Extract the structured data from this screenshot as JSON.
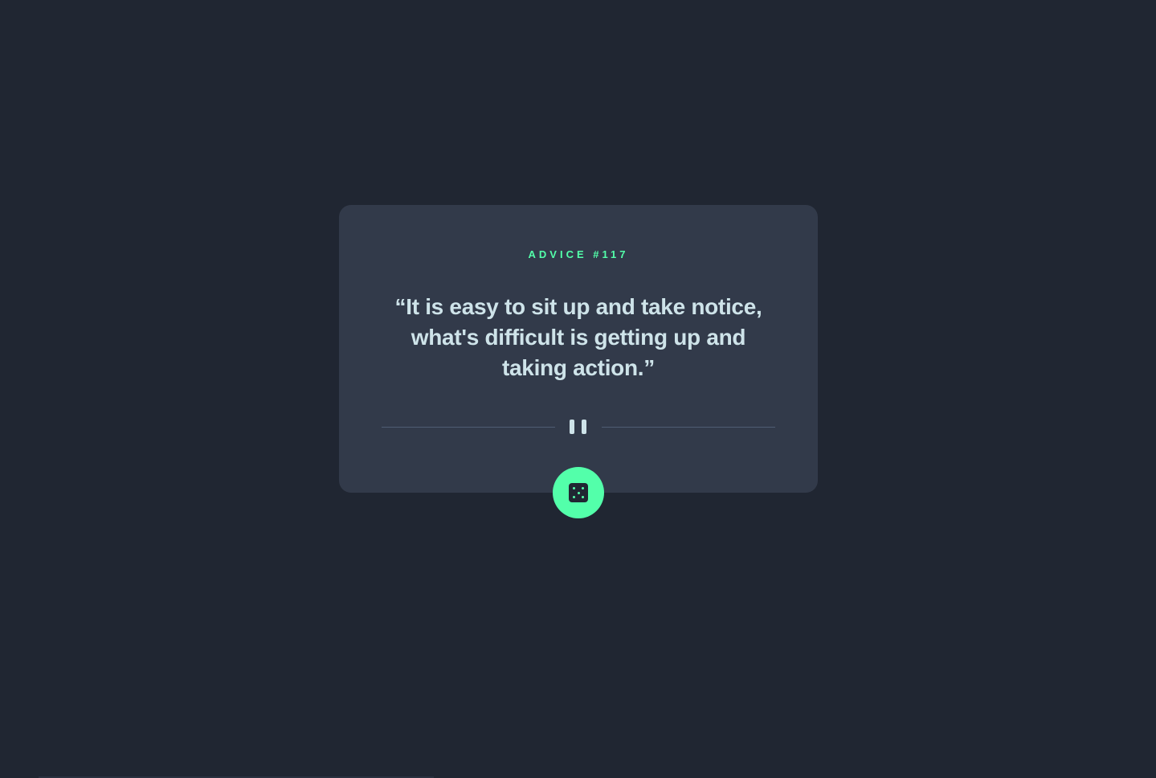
{
  "card": {
    "advice_label": "ADVICE #117",
    "quote": "“It is easy to sit up and take notice, what's difficult is getting up and taking action.”"
  },
  "divider": {
    "icon": "pause-icon"
  },
  "action_button": {
    "icon": "dice-icon"
  },
  "colors": {
    "background": "#202632",
    "card": "#323a4a",
    "accent": "#53ffaa",
    "text": "#cee3e9",
    "divider": "#4f5d74"
  }
}
